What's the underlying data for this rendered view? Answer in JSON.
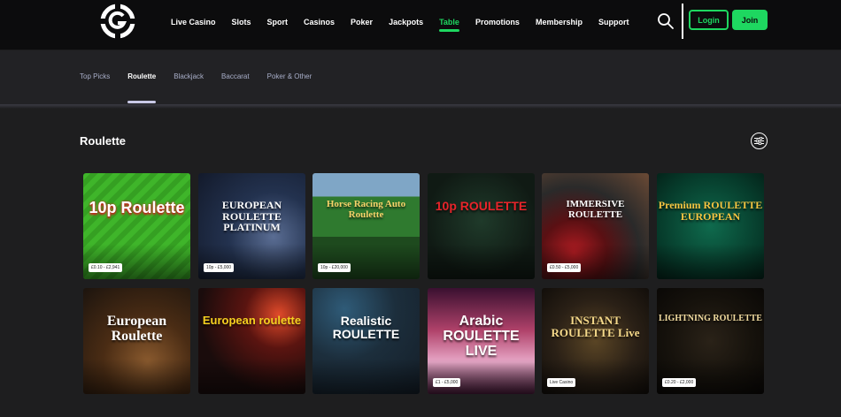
{
  "header": {
    "nav": [
      {
        "label": "Live Casino",
        "name": "nav-live-casino",
        "active": false
      },
      {
        "label": "Slots",
        "name": "nav-slots",
        "active": false
      },
      {
        "label": "Sport",
        "name": "nav-sport",
        "active": false
      },
      {
        "label": "Casinos",
        "name": "nav-casinos",
        "active": false
      },
      {
        "label": "Poker",
        "name": "nav-poker",
        "active": false
      },
      {
        "label": "Jackpots",
        "name": "nav-jackpots",
        "active": false
      },
      {
        "label": "Table",
        "name": "nav-table",
        "active": true
      },
      {
        "label": "Promotions",
        "name": "nav-promotions",
        "active": false
      },
      {
        "label": "Membership",
        "name": "nav-membership",
        "active": false
      },
      {
        "label": "Support",
        "name": "nav-support",
        "active": false
      }
    ],
    "login_label": "Login",
    "join_label": "Join",
    "accent_color": "#1ed760"
  },
  "subtabs": [
    {
      "label": "Top Picks",
      "active": false
    },
    {
      "label": "Roulette",
      "active": true
    },
    {
      "label": "Blackjack",
      "active": false
    },
    {
      "label": "Baccarat",
      "active": false
    },
    {
      "label": "Poker & Other",
      "active": false
    }
  ],
  "section": {
    "title": "Roulette",
    "filter_icon": "sliders-icon"
  },
  "games": [
    {
      "name": "game-10p-roulette",
      "title": "10p Roulette",
      "badge": "£0.10 - £2,941",
      "theme": "green"
    },
    {
      "name": "game-european-roulette-platinum",
      "title": "EUROPEAN ROULETTE PLATINUM",
      "badge": "10p - £5,000",
      "theme": "navy"
    },
    {
      "name": "game-horse-racing-auto-roulette",
      "title": "Horse Racing Auto Roulette",
      "badge": "10p - £20,000",
      "theme": "turf"
    },
    {
      "name": "game-10p-roulette-live",
      "title": "10p ROULETTE",
      "badge": "",
      "theme": "dark-green"
    },
    {
      "name": "game-immersive-roulette",
      "title": "IMMERSIVE ROULETTE",
      "badge": "£0.50 - £5,000",
      "theme": "wheel"
    },
    {
      "name": "game-premium-roulette-european",
      "title": "Premium ROULETTE EUROPEAN",
      "badge": "",
      "theme": "emerald"
    },
    {
      "name": "game-european-roulette",
      "title": "European Roulette",
      "badge": "",
      "theme": "wood"
    },
    {
      "name": "game-european-roulette-fireworks",
      "title": "European roulette",
      "badge": "",
      "theme": "fireworks"
    },
    {
      "name": "game-realistic-roulette",
      "title": "Realistic ROULETTE",
      "badge": "",
      "theme": "slate"
    },
    {
      "name": "game-arabic-roulette-live",
      "title": "Arabic ROULETTE LIVE",
      "badge": "£1 - £5,000",
      "theme": "pink"
    },
    {
      "name": "game-instant-roulette-live",
      "title": "INSTANT ROULETTE Live",
      "badge": "Live Casino",
      "theme": "gold"
    },
    {
      "name": "game-lightning-roulette",
      "title": "LIGHTNING ROULETTE",
      "badge": "£0.20 - £2,000",
      "theme": "black-gold"
    }
  ]
}
